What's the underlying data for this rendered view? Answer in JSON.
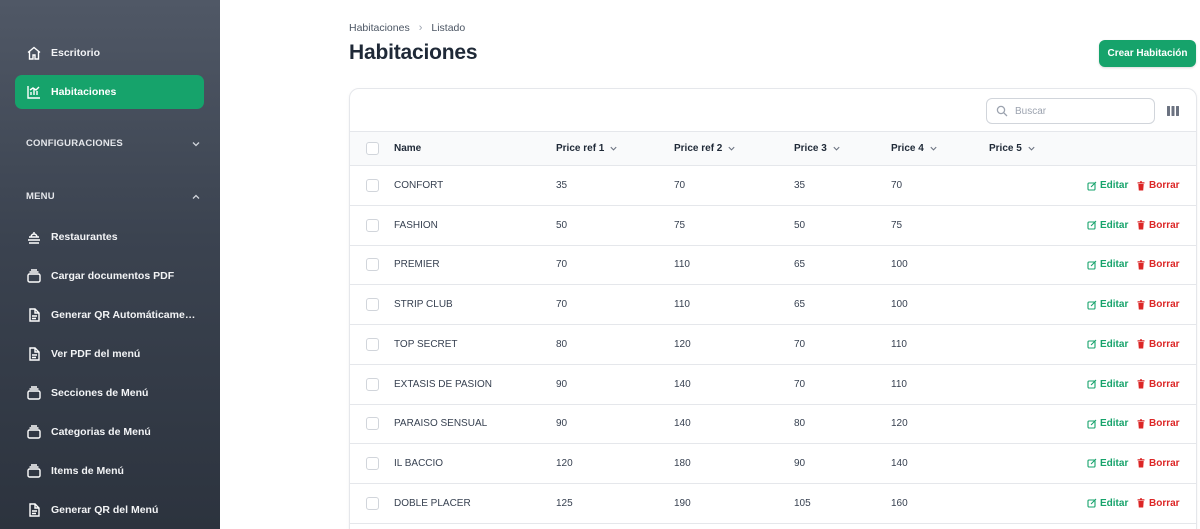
{
  "sidebar": {
    "items_top": [
      {
        "label": "Escritorio",
        "icon": "home-icon",
        "active": false
      },
      {
        "label": "Habitaciones",
        "icon": "chart-icon",
        "active": true
      }
    ],
    "sections": [
      {
        "label": "CONFIGURACIONES",
        "state": "collapsed"
      },
      {
        "label": "MENU",
        "state": "expanded"
      }
    ],
    "menu_items": [
      {
        "label": "Restaurantes",
        "icon": "restaurant-icon"
      },
      {
        "label": "Cargar documentos PDF",
        "icon": "upload-icon"
      },
      {
        "label": "Generar QR Automáticamente",
        "icon": "document-icon"
      },
      {
        "label": "Ver PDF del menú",
        "icon": "document-icon"
      },
      {
        "label": "Secciones de Menú",
        "icon": "stack-icon"
      },
      {
        "label": "Categorias de Menú",
        "icon": "stack-icon"
      },
      {
        "label": "Items de Menú",
        "icon": "stack-icon"
      },
      {
        "label": "Generar QR del Menú",
        "icon": "document-icon"
      }
    ]
  },
  "breadcrumb": {
    "items": [
      "Habitaciones",
      "Listado"
    ]
  },
  "page": {
    "title": "Habitaciones",
    "create_label": "Crear Habitación"
  },
  "search": {
    "placeholder": "Buscar"
  },
  "table": {
    "headers": [
      "Name",
      "Price ref 1",
      "Price ref 2",
      "Price 3",
      "Price 4",
      "Price 5"
    ],
    "rows": [
      [
        "CONFORT",
        "35",
        "70",
        "35",
        "70",
        ""
      ],
      [
        "FASHION",
        "50",
        "75",
        "50",
        "75",
        ""
      ],
      [
        "PREMIER",
        "70",
        "110",
        "65",
        "100",
        ""
      ],
      [
        "STRIP CLUB",
        "70",
        "110",
        "65",
        "100",
        ""
      ],
      [
        "TOP SECRET",
        "80",
        "120",
        "70",
        "110",
        ""
      ],
      [
        "EXTASIS DE PASION",
        "90",
        "140",
        "70",
        "110",
        ""
      ],
      [
        "PARAISO SENSUAL",
        "90",
        "140",
        "80",
        "120",
        ""
      ],
      [
        "IL BACCIO",
        "120",
        "180",
        "90",
        "140",
        ""
      ],
      [
        "DOBLE PLACER",
        "125",
        "190",
        "105",
        "160",
        ""
      ]
    ],
    "edit_label": "Editar",
    "delete_label": "Borrar"
  },
  "colors": {
    "accent": "#16a36b",
    "danger": "#dc2626",
    "sidebar_top": "#505866",
    "sidebar_bottom": "#2c333e"
  }
}
